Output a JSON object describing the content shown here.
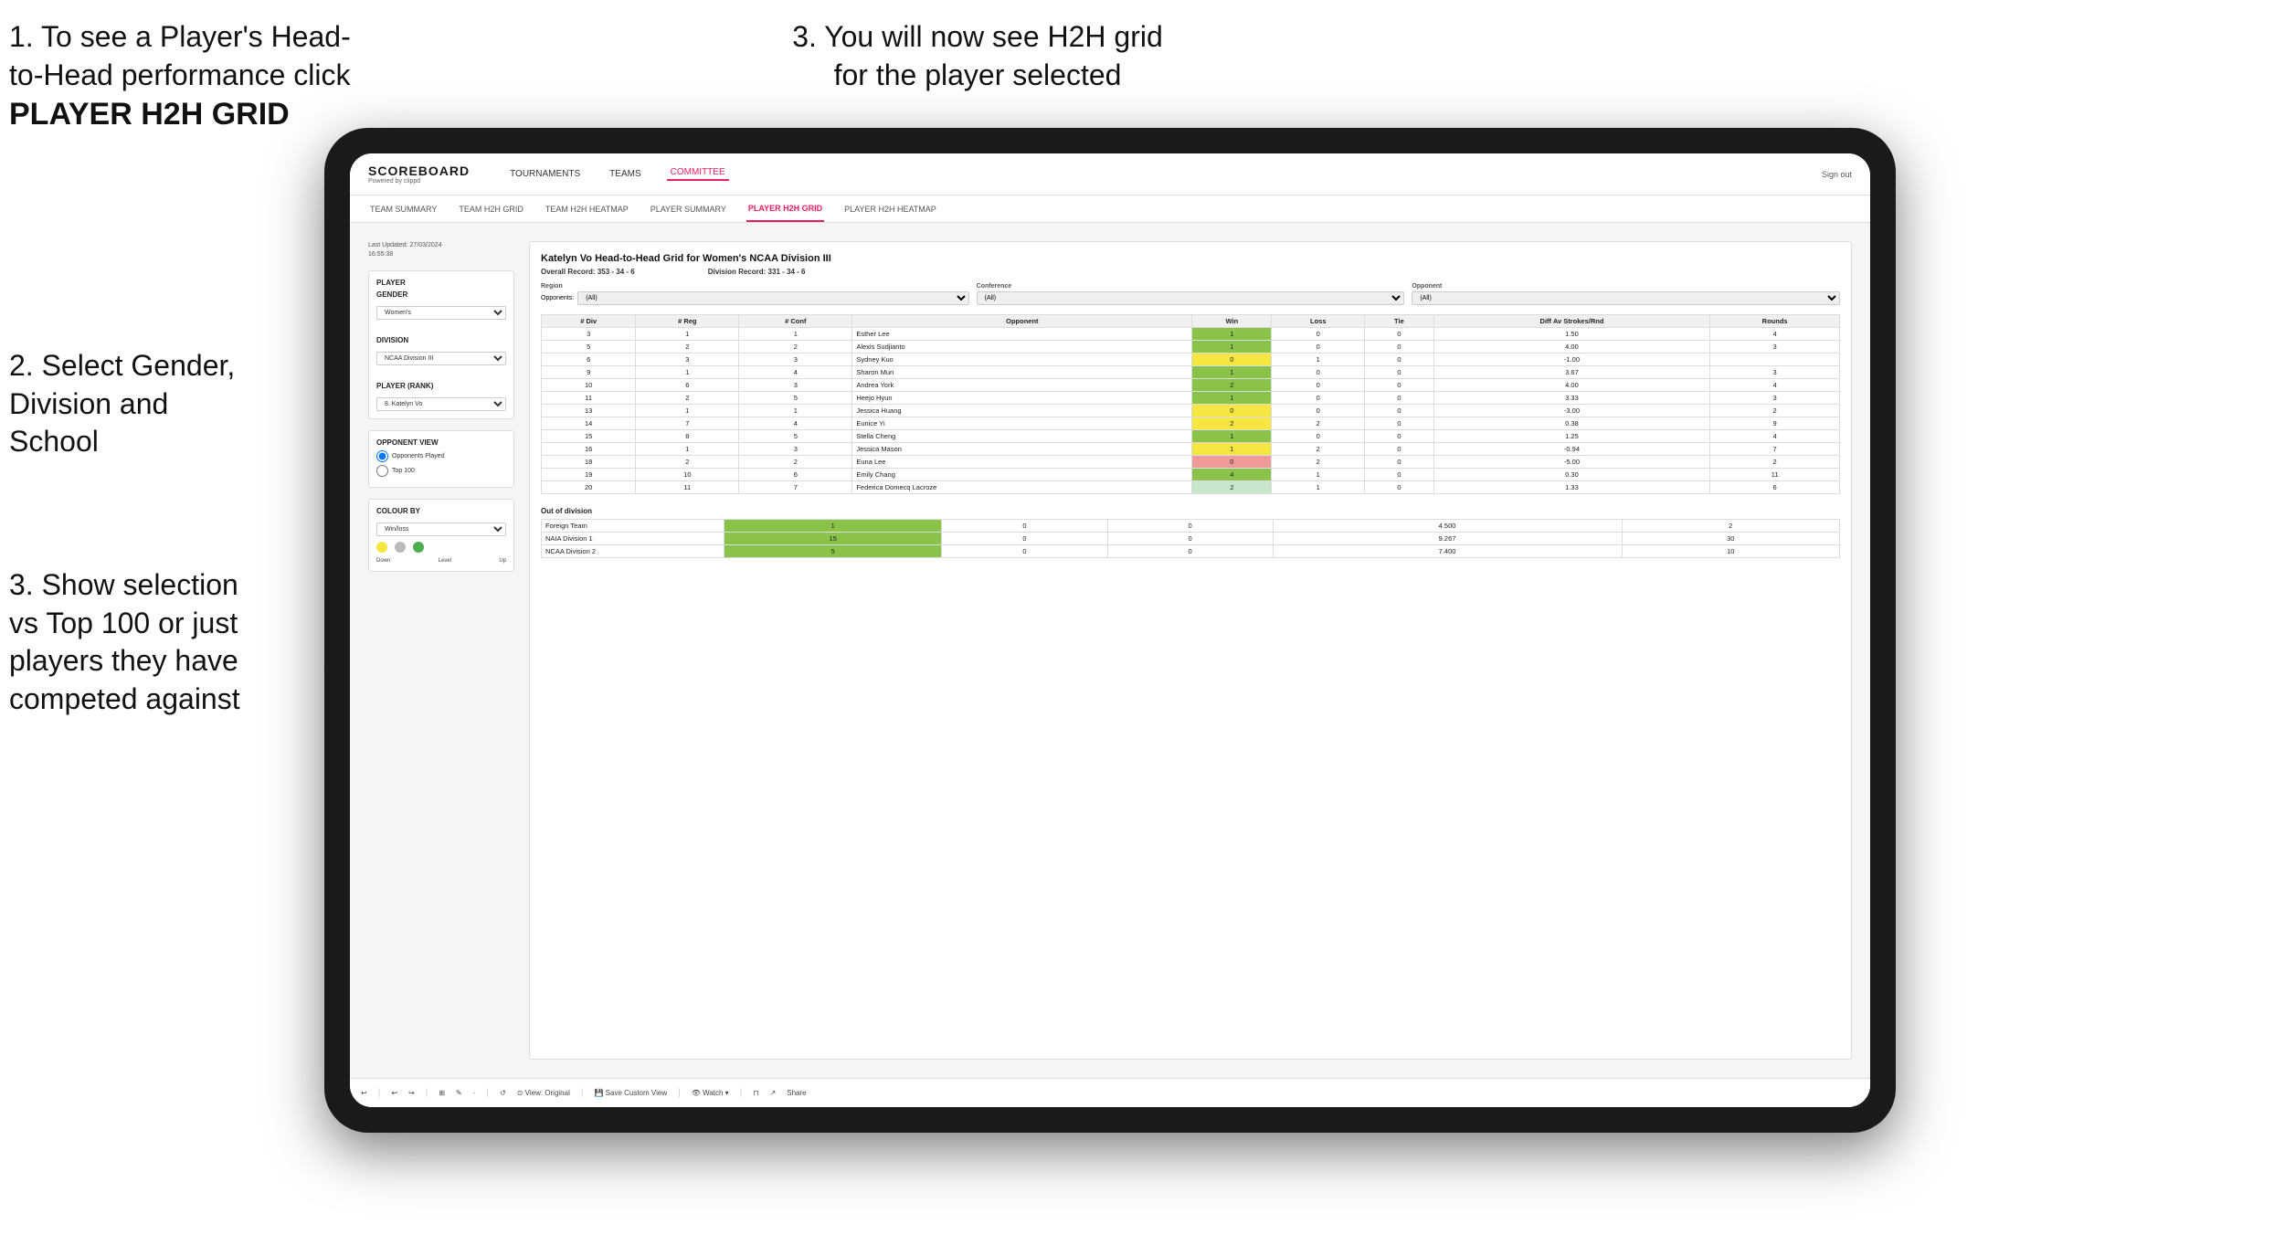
{
  "instructions": {
    "top_left_line1": "1. To see a Player's Head-",
    "top_left_line2": "to-Head performance click",
    "top_left_bold": "PLAYER H2H GRID",
    "top_right": "3. You will now see H2H grid\nfor the player selected",
    "mid_left_title": "2. Select Gender,",
    "mid_left_body": "Division and\nSchool",
    "bot_left_title": "3. Show selection",
    "bot_left_body": "vs Top 100 or just\nplayers they have\ncompeted against"
  },
  "nav": {
    "logo": "SCOREBOARD",
    "logo_sub": "Powered by clippd",
    "items": [
      "TOURNAMENTS",
      "TEAMS",
      "COMMITTEE"
    ],
    "active_item": "COMMITTEE",
    "sign_out": "Sign out"
  },
  "sub_nav": {
    "items": [
      "TEAM SUMMARY",
      "TEAM H2H GRID",
      "TEAM H2H HEATMAP",
      "PLAYER SUMMARY",
      "PLAYER H2H GRID",
      "PLAYER H2H HEATMAP"
    ],
    "active": "PLAYER H2H GRID"
  },
  "sidebar": {
    "last_updated_label": "Last Updated: 27/03/2024",
    "last_updated_time": "16:55:38",
    "player_label": "Player",
    "gender_label": "Gender",
    "gender_value": "Women's",
    "division_label": "Division",
    "division_value": "NCAA Division III",
    "player_rank_label": "Player (Rank)",
    "player_rank_value": "8. Katelyn Vo",
    "opponent_view_label": "Opponent view",
    "radio1": "Opponents Played",
    "radio2": "Top 100",
    "colour_label": "Colour by",
    "colour_value": "Win/loss",
    "colour_down": "Down",
    "colour_level": "Level",
    "colour_up": "Up"
  },
  "h2h": {
    "title": "Katelyn Vo Head-to-Head Grid for Women's NCAA Division III",
    "overall_record_label": "Overall Record:",
    "overall_record_value": "353 - 34 - 6",
    "division_record_label": "Division Record:",
    "division_record_value": "331 - 34 - 6",
    "filter_region_label": "Region",
    "filter_conference_label": "Conference",
    "filter_opponent_label": "Opponent",
    "opponents_label": "Opponents:",
    "opponents_value": "(All)",
    "conference_value": "(All)",
    "opponent_value": "(All)",
    "col_headers": [
      "# Div",
      "# Reg",
      "# Conf",
      "Opponent",
      "Win",
      "Loss",
      "Tie",
      "Diff Av Strokes/Rnd",
      "Rounds"
    ],
    "rows": [
      {
        "div": 3,
        "reg": 1,
        "conf": 1,
        "opponent": "Esther Lee",
        "win": 1,
        "loss": 0,
        "tie": 0,
        "diff": "1.50",
        "rounds": 4,
        "win_color": "green"
      },
      {
        "div": 5,
        "reg": 2,
        "conf": 2,
        "opponent": "Alexis Sudjianto",
        "win": 1,
        "loss": 0,
        "tie": 0,
        "diff": "4.00",
        "rounds": 3,
        "win_color": "green"
      },
      {
        "div": 6,
        "reg": 3,
        "conf": 3,
        "opponent": "Sydney Kuo",
        "win": 0,
        "loss": 1,
        "tie": 0,
        "diff": "-1.00",
        "rounds": "",
        "win_color": "yellow"
      },
      {
        "div": 9,
        "reg": 1,
        "conf": 4,
        "opponent": "Sharon Mun",
        "win": 1,
        "loss": 0,
        "tie": 0,
        "diff": "3.67",
        "rounds": 3,
        "win_color": "green"
      },
      {
        "div": 10,
        "reg": 6,
        "conf": 3,
        "opponent": "Andrea York",
        "win": 2,
        "loss": 0,
        "tie": 0,
        "diff": "4.00",
        "rounds": 4,
        "win_color": "green"
      },
      {
        "div": 11,
        "reg": 2,
        "conf": 5,
        "opponent": "Heejo Hyun",
        "win": 1,
        "loss": 0,
        "tie": 0,
        "diff": "3.33",
        "rounds": 3,
        "win_color": "green"
      },
      {
        "div": 13,
        "reg": 1,
        "conf": 1,
        "opponent": "Jessica Huang",
        "win": 0,
        "loss": 0,
        "tie": 0,
        "diff": "-3.00",
        "rounds": 2,
        "win_color": "yellow"
      },
      {
        "div": 14,
        "reg": 7,
        "conf": 4,
        "opponent": "Eunice Yi",
        "win": 2,
        "loss": 2,
        "tie": 0,
        "diff": "0.38",
        "rounds": 9,
        "win_color": "yellow"
      },
      {
        "div": 15,
        "reg": 8,
        "conf": 5,
        "opponent": "Stella Cheng",
        "win": 1,
        "loss": 0,
        "tie": 0,
        "diff": "1.25",
        "rounds": 4,
        "win_color": "green"
      },
      {
        "div": 16,
        "reg": 1,
        "conf": 3,
        "opponent": "Jessica Mason",
        "win": 1,
        "loss": 2,
        "tie": 0,
        "diff": "-0.94",
        "rounds": 7,
        "win_color": "yellow"
      },
      {
        "div": 18,
        "reg": 2,
        "conf": 2,
        "opponent": "Euna Lee",
        "win": 0,
        "loss": 2,
        "tie": 0,
        "diff": "-5.00",
        "rounds": 2,
        "win_color": "red"
      },
      {
        "div": 19,
        "reg": 10,
        "conf": 6,
        "opponent": "Emily Chang",
        "win": 4,
        "loss": 1,
        "tie": 0,
        "diff": "0.30",
        "rounds": 11,
        "win_color": "green"
      },
      {
        "div": 20,
        "reg": 11,
        "conf": 7,
        "opponent": "Federica Domecq Lacroze",
        "win": 2,
        "loss": 1,
        "tie": 0,
        "diff": "1.33",
        "rounds": 6,
        "win_color": "light-green"
      }
    ],
    "out_of_division_title": "Out of division",
    "out_rows": [
      {
        "opponent": "Foreign Team",
        "win": 1,
        "loss": 0,
        "tie": 0,
        "diff": "4.500",
        "rounds": 2,
        "win_color": "green"
      },
      {
        "opponent": "NAIA Division 1",
        "win": 15,
        "loss": 0,
        "tie": 0,
        "diff": "9.267",
        "rounds": 30,
        "win_color": "green"
      },
      {
        "opponent": "NCAA Division 2",
        "win": 5,
        "loss": 0,
        "tie": 0,
        "diff": "7.400",
        "rounds": 10,
        "win_color": "green"
      }
    ]
  },
  "toolbar": {
    "buttons": [
      "↩",
      "↩",
      "↪",
      "⊞",
      "✎",
      "·",
      "↺",
      "⊙",
      "View: Original",
      "Save Custom View",
      "Watch ▾",
      "⊓",
      "↗",
      "Share"
    ]
  }
}
